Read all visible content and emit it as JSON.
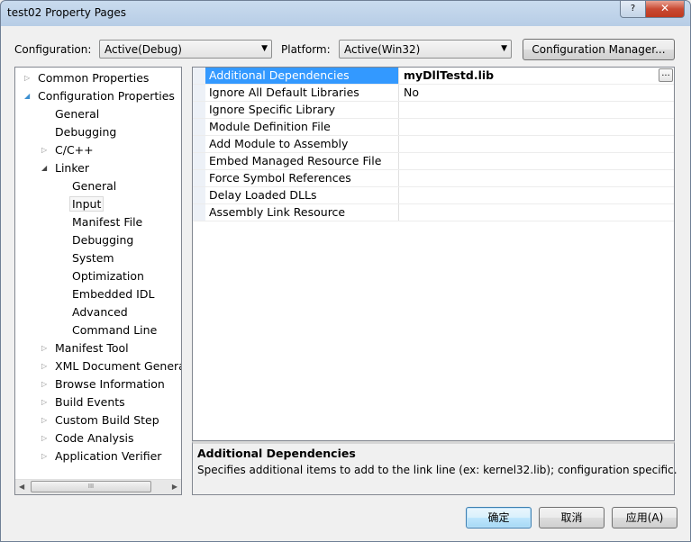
{
  "window": {
    "title": "test02 Property Pages",
    "help_label": "?",
    "close_label": "✕"
  },
  "toolbar": {
    "configuration_label": "Configuration:",
    "configuration_value": "Active(Debug)",
    "platform_label": "Platform:",
    "platform_value": "Active(Win32)",
    "config_manager_label": "Configuration Manager..."
  },
  "tree": {
    "common_properties": "Common Properties",
    "configuration_properties": "Configuration Properties",
    "general": "General",
    "debugging": "Debugging",
    "cpp": "C/C++",
    "linker": "Linker",
    "linker_children": {
      "general": "General",
      "input": "Input",
      "manifest_file": "Manifest File",
      "debugging": "Debugging",
      "system": "System",
      "optimization": "Optimization",
      "embedded_idl": "Embedded IDL",
      "advanced": "Advanced",
      "command_line": "Command Line"
    },
    "manifest_tool": "Manifest Tool",
    "xml_document_generator": "XML Document Generat",
    "browse_information": "Browse Information",
    "build_events": "Build Events",
    "custom_build_step": "Custom Build Step",
    "code_analysis": "Code Analysis",
    "application_verifier": "Application Verifier",
    "scroll_thumb": "III"
  },
  "grid": {
    "rows": [
      {
        "name": "Additional Dependencies",
        "value": "myDllTestd.lib",
        "ellipsis": "..."
      },
      {
        "name": "Ignore All Default Libraries",
        "value": "No"
      },
      {
        "name": "Ignore Specific Library",
        "value": ""
      },
      {
        "name": "Module Definition File",
        "value": ""
      },
      {
        "name": "Add Module to Assembly",
        "value": ""
      },
      {
        "name": "Embed Managed Resource File",
        "value": ""
      },
      {
        "name": "Force Symbol References",
        "value": ""
      },
      {
        "name": "Delay Loaded DLLs",
        "value": ""
      },
      {
        "name": "Assembly Link Resource",
        "value": ""
      }
    ]
  },
  "description": {
    "title": "Additional Dependencies",
    "text": "Specifies additional items to add to the link line (ex: kernel32.lib); configuration specific."
  },
  "buttons": {
    "ok": "确定",
    "cancel": "取消",
    "apply": "应用(A)"
  },
  "colors": {
    "selection": "#3399ff",
    "window_frame": "#b7cde6",
    "close_button": "#c94a33"
  }
}
